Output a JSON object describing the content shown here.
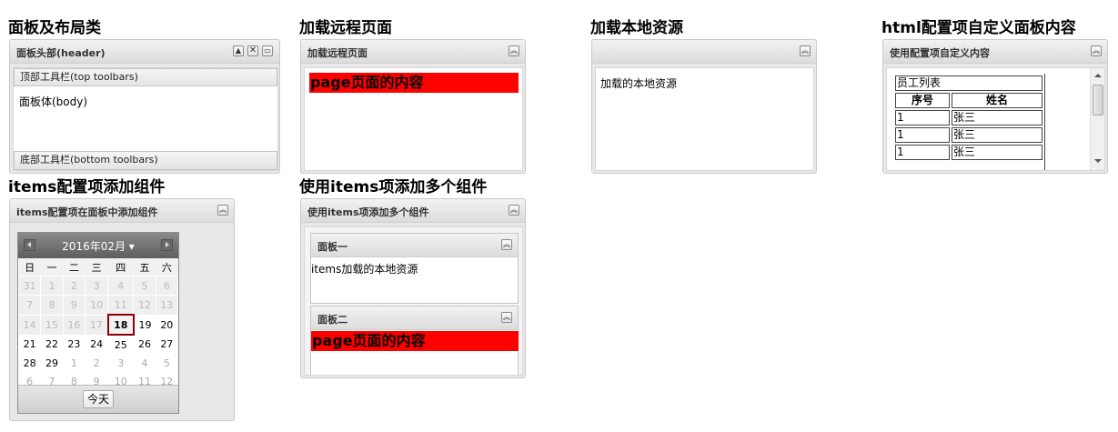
{
  "sections": {
    "layout": {
      "heading": "面板及布局类",
      "title": "面板头部(header)",
      "top_toolbar": "顶部工具栏(top toolbars)",
      "body": "面板体(body)",
      "bottom_toolbar": "底部工具栏(bottom toolbars)"
    },
    "remote": {
      "heading": "加载远程页面",
      "title": "加载远程页面",
      "content": "page页面的内容"
    },
    "local": {
      "heading": "加载本地资源",
      "title": "",
      "content": "加载的本地资源"
    },
    "html": {
      "heading": "html配置项自定义面板内容",
      "title": "使用配置项自定义内容",
      "table": {
        "caption": "员工列表",
        "headers": [
          "序号",
          "姓名"
        ],
        "rows": [
          [
            "1",
            "张三"
          ],
          [
            "1",
            "张三"
          ],
          [
            "1",
            "张三"
          ]
        ]
      }
    },
    "items_add": {
      "heading": "items配置项添加组件",
      "title": "items配置项在面板中添加组件",
      "calendar": {
        "month_label": "2016年02月 ▾",
        "weekdays": [
          "日",
          "一",
          "二",
          "三",
          "四",
          "五",
          "六"
        ],
        "weeks": [
          [
            "31",
            "1",
            "2",
            "3",
            "4",
            "5",
            "6"
          ],
          [
            "7",
            "8",
            "9",
            "10",
            "11",
            "12",
            "13"
          ],
          [
            "14",
            "15",
            "16",
            "17",
            "18",
            "19",
            "20"
          ],
          [
            "21",
            "22",
            "23",
            "24",
            "25",
            "26",
            "27"
          ],
          [
            "28",
            "29",
            "1",
            "2",
            "3",
            "4",
            "5"
          ],
          [
            "6",
            "7",
            "8",
            "9",
            "10",
            "11",
            "12"
          ]
        ],
        "today_button": "今天"
      }
    },
    "items_multi": {
      "heading": "使用items项添加多个组件",
      "title": "使用items项添加多个组件",
      "panel1": {
        "title": "面板一",
        "content": "items加载的本地资源"
      },
      "panel2": {
        "title": "面板二",
        "content": "page页面的内容"
      }
    }
  },
  "icons": {
    "collapse": "double-chevron-up-icon",
    "minimize": "triangle-up-icon",
    "close": "close-icon",
    "maximize": "maximize-icon"
  },
  "colors": {
    "highlight_red": "#ff0000",
    "today_border": "#8b0000"
  }
}
